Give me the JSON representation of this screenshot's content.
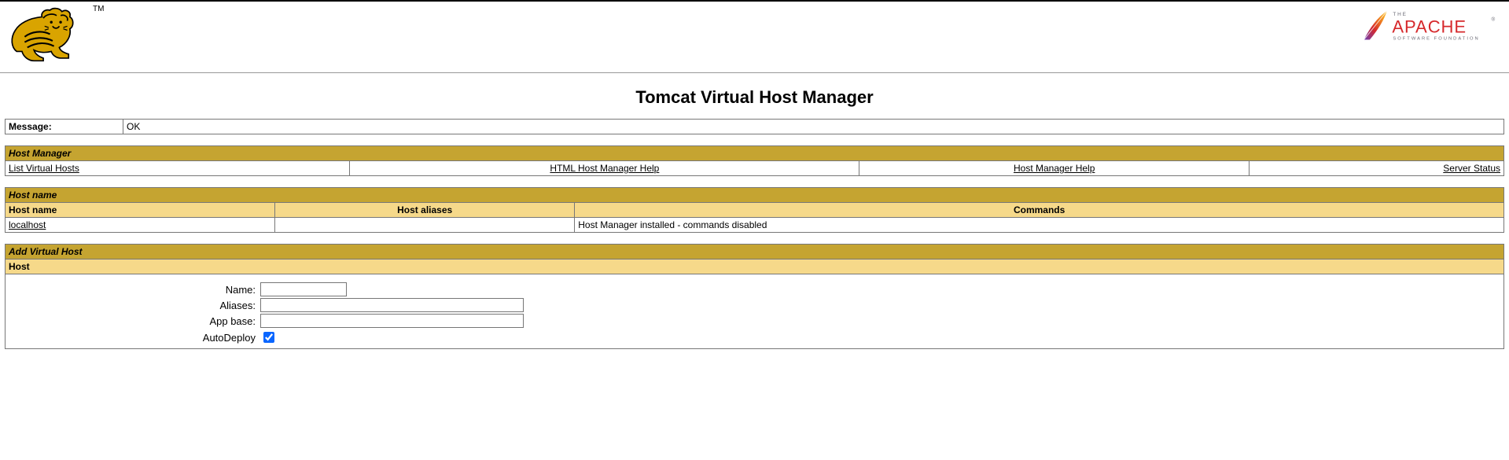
{
  "header": {
    "trademark": "TM",
    "apache_the": "THE",
    "apache_name": "APACHE",
    "apache_reg": "®",
    "apache_sub": "SOFTWARE FOUNDATION"
  },
  "page_title": "Tomcat Virtual Host Manager",
  "message": {
    "label": "Message:",
    "value": "OK"
  },
  "host_manager": {
    "title": "Host Manager",
    "links": {
      "list": "List Virtual Hosts",
      "html_help": "HTML Host Manager Help",
      "help": "Host Manager Help",
      "status": "Server Status"
    }
  },
  "hosts_table": {
    "title": "Host name",
    "cols": {
      "name": "Host name",
      "aliases": "Host aliases",
      "commands": "Commands"
    },
    "rows": [
      {
        "name": "localhost",
        "aliases": "",
        "commands": "Host Manager installed - commands disabled"
      }
    ]
  },
  "add_host": {
    "title": "Add Virtual Host",
    "sub": "Host",
    "labels": {
      "name": "Name:",
      "aliases": "Aliases:",
      "appbase": "App base:",
      "autodeploy": "AutoDeploy"
    },
    "values": {
      "name": "",
      "aliases": "",
      "appbase": "",
      "autodeploy_checked": true
    }
  }
}
